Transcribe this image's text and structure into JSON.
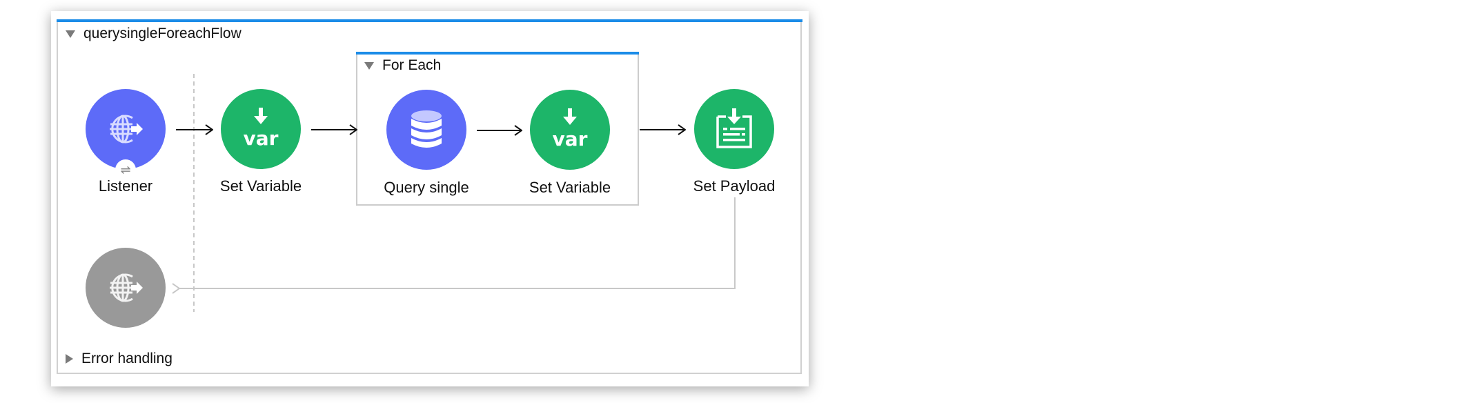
{
  "flow": {
    "name": "querysingleForeachFlow",
    "error_handling_label": "Error handling",
    "accent_color": "#1b8ce8"
  },
  "scope": {
    "name": "For Each"
  },
  "nodes": [
    {
      "id": "listener",
      "label": "Listener",
      "icon": "http-listener-globe-icon",
      "color": "#5d6bf8",
      "badge": "⇌"
    },
    {
      "id": "set-variable-1",
      "label": "Set Variable",
      "icon": "set-variable-icon",
      "icon_text": "var",
      "color": "#1db569"
    },
    {
      "id": "query-single",
      "label": "Query single",
      "icon": "database-icon",
      "color": "#5d6bf8"
    },
    {
      "id": "set-variable-2",
      "label": "Set Variable",
      "icon": "set-variable-icon",
      "icon_text": "var",
      "color": "#1db569"
    },
    {
      "id": "set-payload",
      "label": "Set Payload",
      "icon": "set-payload-icon",
      "color": "#1db569"
    },
    {
      "id": "response",
      "label": "",
      "icon": "http-response-globe-icon",
      "color": "#999999"
    }
  ]
}
